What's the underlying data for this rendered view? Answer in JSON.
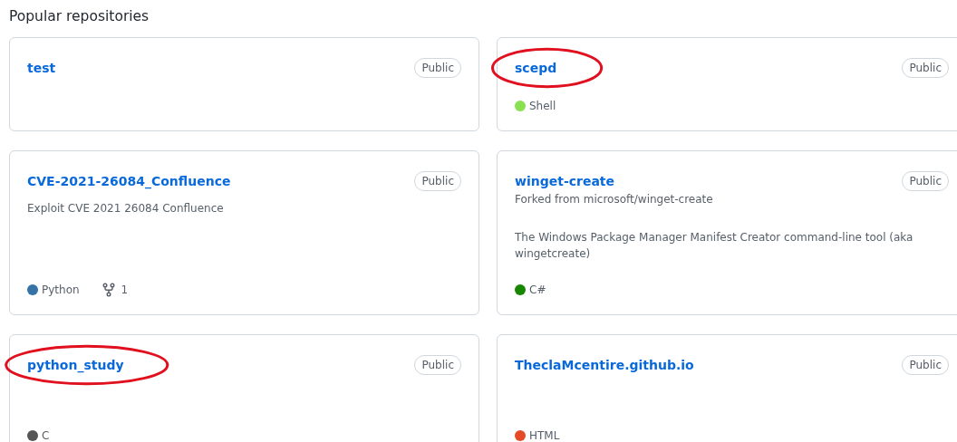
{
  "heading": "Popular repositories",
  "repositories": [
    {
      "name": "test",
      "visibility": "Public",
      "circled": false
    },
    {
      "name": "scepd",
      "visibility": "Public",
      "circled": true,
      "language": {
        "name": "Shell",
        "color": "#89e051"
      }
    },
    {
      "name": "CVE-2021-26084_Confluence",
      "visibility": "Public",
      "circled": false,
      "description": "Exploit CVE 2021 26084 Confluence",
      "language": {
        "name": "Python",
        "color": "#3572a5"
      },
      "forks": "1"
    },
    {
      "name": "winget-create",
      "visibility": "Public",
      "circled": false,
      "forked_from": "Forked from microsoft/winget-create",
      "description": "The Windows Package Manager Manifest Creator command-line tool (aka wingetcreate)",
      "language": {
        "name": "C#",
        "color": "#178600"
      }
    },
    {
      "name": "python_study",
      "visibility": "Public",
      "circled": true,
      "language": {
        "name": "C",
        "color": "#555555"
      }
    },
    {
      "name": "TheclaMcentire.github.io",
      "visibility": "Public",
      "circled": false,
      "language": {
        "name": "HTML",
        "color": "#e34c26"
      }
    }
  ]
}
